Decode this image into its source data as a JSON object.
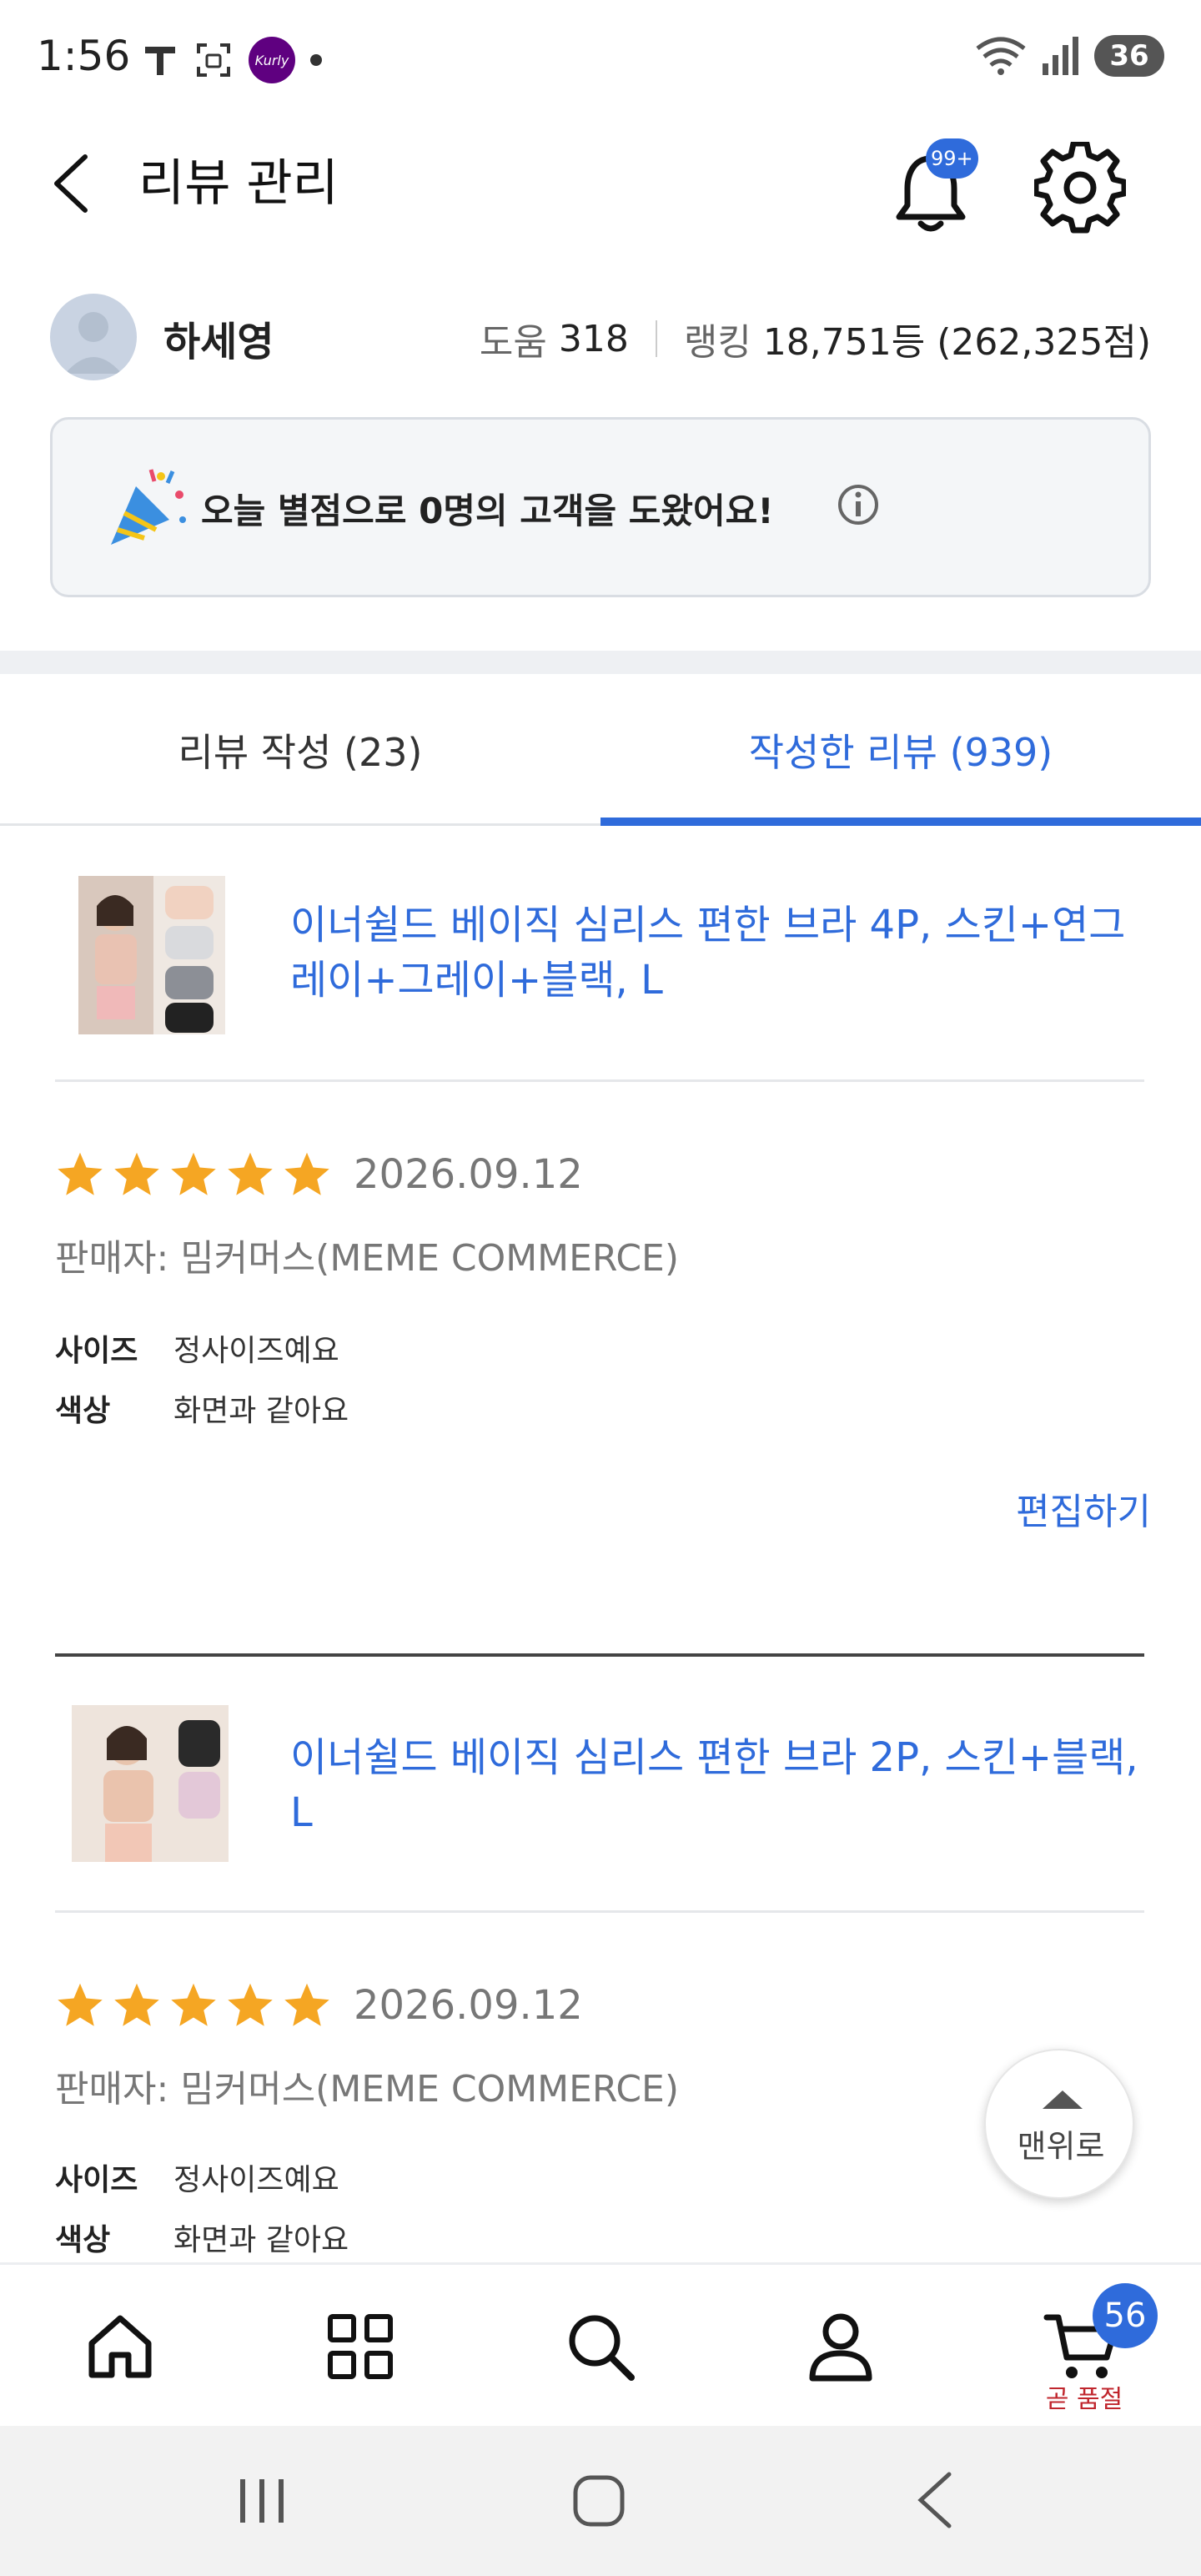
{
  "status_bar": {
    "time": "1:56",
    "battery": "36",
    "app_badge": "Kurly"
  },
  "header": {
    "title": "리뷰 관리",
    "notification_badge": "99+"
  },
  "profile": {
    "name": "하세영",
    "help_label": "도움",
    "help_value": "318",
    "ranking_label": "랭킹",
    "ranking_value": "18,751등 (262,325점)"
  },
  "banner": {
    "text": "오늘 별점으로 0명의 고객을 도왔어요!"
  },
  "tabs": [
    {
      "label": "리뷰 작성 (23)",
      "active": false
    },
    {
      "label": "작성한 리뷰 (939)",
      "active": true
    }
  ],
  "reviews": [
    {
      "product_name": "이너쉴드 베이직 심리스 편한 브라 4P, 스킨+연그레이+그레이+블랙, L",
      "rating": 5,
      "date": "2026.09.12",
      "seller": "판매자: 밈커머스(MEME COMMERCE)",
      "attributes": [
        {
          "key": "사이즈",
          "value": "정사이즈예요"
        },
        {
          "key": "색상",
          "value": "화면과 같아요"
        }
      ],
      "edit_label": "편집하기"
    },
    {
      "product_name": "이너쉴드 베이직 심리스 편한 브라 2P, 스킨+블랙, L",
      "rating": 5,
      "date": "2026.09.12",
      "seller": "판매자: 밈커머스(MEME COMMERCE)",
      "attributes": [
        {
          "key": "사이즈",
          "value": "정사이즈예요"
        },
        {
          "key": "색상",
          "value": "화면과 같아요"
        }
      ]
    }
  ],
  "scroll_top_label": "맨위로",
  "bottom_nav": {
    "cart_count": "56",
    "cart_label": "곧 품절",
    "items": [
      "home-icon",
      "category-grid-icon",
      "search-icon",
      "profile-icon",
      "cart-icon"
    ]
  },
  "colors": {
    "accent": "#2f6bdb",
    "star": "#f5a623",
    "soldout": "#c0262d"
  }
}
